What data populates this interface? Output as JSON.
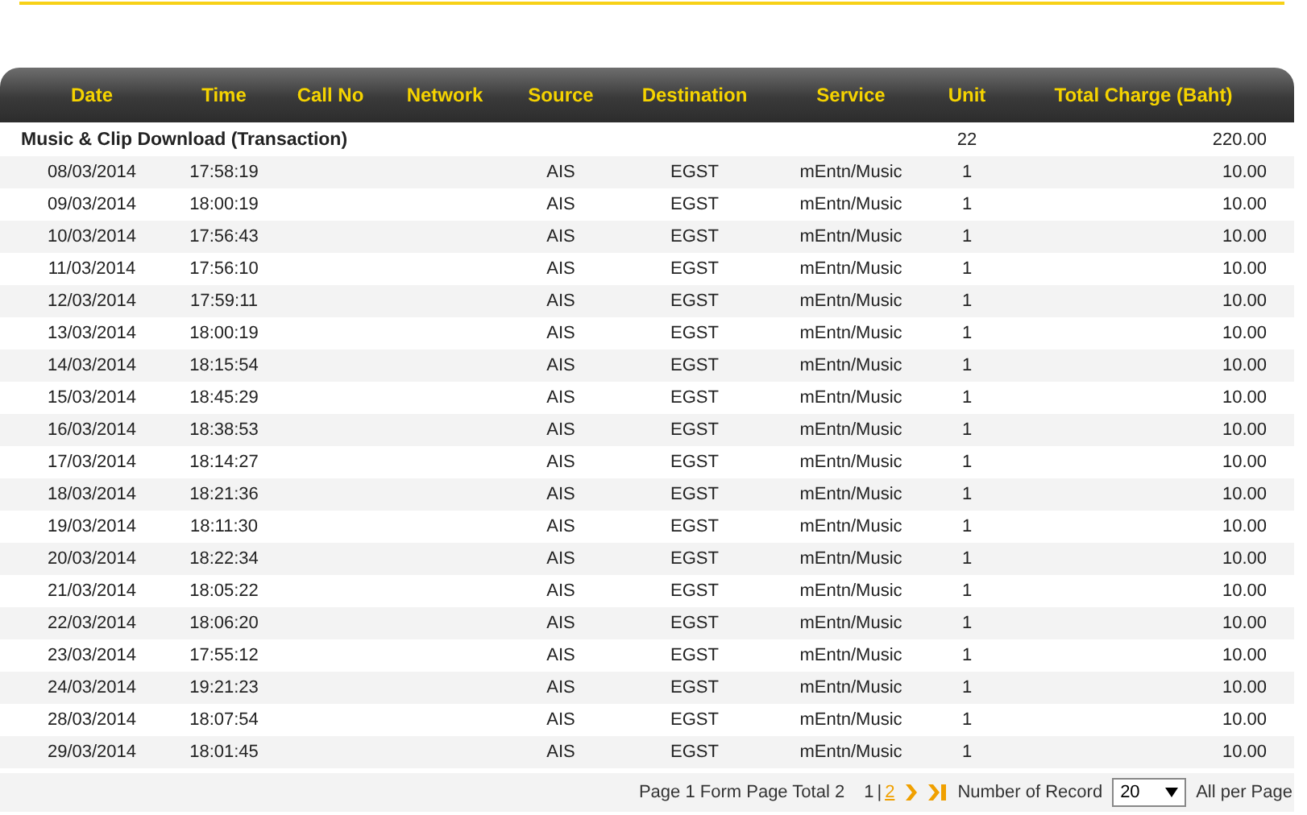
{
  "table": {
    "columns": [
      "Date",
      "Time",
      "Call No",
      "Network",
      "Source",
      "Destination",
      "Service",
      "Unit",
      "Total Charge (Baht)"
    ],
    "group": {
      "title": "Music & Clip Download (Transaction)",
      "unit": "22",
      "total": "220.00"
    },
    "rows": [
      {
        "date": "08/03/2014",
        "time": "17:58:19",
        "source": "AIS",
        "destination": "EGST",
        "service": "mEntn/Music",
        "unit": "1",
        "total": "10.00"
      },
      {
        "date": "09/03/2014",
        "time": "18:00:19",
        "source": "AIS",
        "destination": "EGST",
        "service": "mEntn/Music",
        "unit": "1",
        "total": "10.00"
      },
      {
        "date": "10/03/2014",
        "time": "17:56:43",
        "source": "AIS",
        "destination": "EGST",
        "service": "mEntn/Music",
        "unit": "1",
        "total": "10.00"
      },
      {
        "date": "11/03/2014",
        "time": "17:56:10",
        "source": "AIS",
        "destination": "EGST",
        "service": "mEntn/Music",
        "unit": "1",
        "total": "10.00"
      },
      {
        "date": "12/03/2014",
        "time": "17:59:11",
        "source": "AIS",
        "destination": "EGST",
        "service": "mEntn/Music",
        "unit": "1",
        "total": "10.00"
      },
      {
        "date": "13/03/2014",
        "time": "18:00:19",
        "source": "AIS",
        "destination": "EGST",
        "service": "mEntn/Music",
        "unit": "1",
        "total": "10.00"
      },
      {
        "date": "14/03/2014",
        "time": "18:15:54",
        "source": "AIS",
        "destination": "EGST",
        "service": "mEntn/Music",
        "unit": "1",
        "total": "10.00"
      },
      {
        "date": "15/03/2014",
        "time": "18:45:29",
        "source": "AIS",
        "destination": "EGST",
        "service": "mEntn/Music",
        "unit": "1",
        "total": "10.00"
      },
      {
        "date": "16/03/2014",
        "time": "18:38:53",
        "source": "AIS",
        "destination": "EGST",
        "service": "mEntn/Music",
        "unit": "1",
        "total": "10.00"
      },
      {
        "date": "17/03/2014",
        "time": "18:14:27",
        "source": "AIS",
        "destination": "EGST",
        "service": "mEntn/Music",
        "unit": "1",
        "total": "10.00"
      },
      {
        "date": "18/03/2014",
        "time": "18:21:36",
        "source": "AIS",
        "destination": "EGST",
        "service": "mEntn/Music",
        "unit": "1",
        "total": "10.00"
      },
      {
        "date": "19/03/2014",
        "time": "18:11:30",
        "source": "AIS",
        "destination": "EGST",
        "service": "mEntn/Music",
        "unit": "1",
        "total": "10.00"
      },
      {
        "date": "20/03/2014",
        "time": "18:22:34",
        "source": "AIS",
        "destination": "EGST",
        "service": "mEntn/Music",
        "unit": "1",
        "total": "10.00"
      },
      {
        "date": "21/03/2014",
        "time": "18:05:22",
        "source": "AIS",
        "destination": "EGST",
        "service": "mEntn/Music",
        "unit": "1",
        "total": "10.00"
      },
      {
        "date": "22/03/2014",
        "time": "18:06:20",
        "source": "AIS",
        "destination": "EGST",
        "service": "mEntn/Music",
        "unit": "1",
        "total": "10.00"
      },
      {
        "date": "23/03/2014",
        "time": "17:55:12",
        "source": "AIS",
        "destination": "EGST",
        "service": "mEntn/Music",
        "unit": "1",
        "total": "10.00"
      },
      {
        "date": "24/03/2014",
        "time": "19:21:23",
        "source": "AIS",
        "destination": "EGST",
        "service": "mEntn/Music",
        "unit": "1",
        "total": "10.00"
      },
      {
        "date": "28/03/2014",
        "time": "18:07:54",
        "source": "AIS",
        "destination": "EGST",
        "service": "mEntn/Music",
        "unit": "1",
        "total": "10.00"
      },
      {
        "date": "29/03/2014",
        "time": "18:01:45",
        "source": "AIS",
        "destination": "EGST",
        "service": "mEntn/Music",
        "unit": "1",
        "total": "10.00"
      }
    ]
  },
  "pager": {
    "summary": "Page 1 Form Page Total 2",
    "pages": [
      {
        "label": "1",
        "selected": true
      },
      {
        "label": "2",
        "selected": false
      }
    ],
    "separator": "|",
    "records_label": "Number of Record",
    "records_value": "20",
    "per_page_label": "All per Page"
  }
}
